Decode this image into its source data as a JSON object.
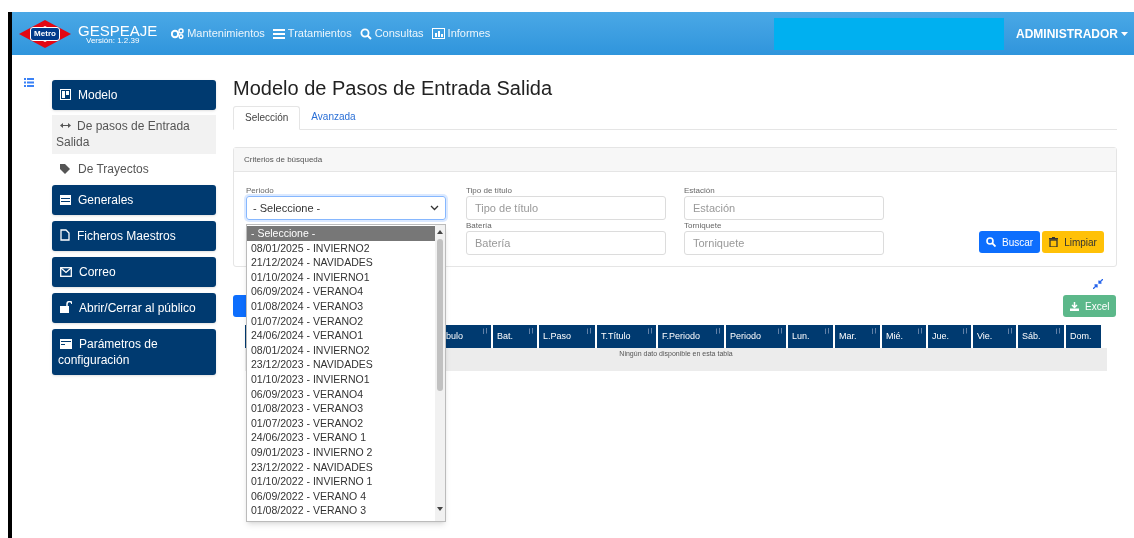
{
  "navbar": {
    "logo_text": "Metro",
    "app_name": "GESPEAJE",
    "version": "Versión: 1.2.39",
    "menu": [
      {
        "label": "Mantenimientos"
      },
      {
        "label": "Tratamientos"
      },
      {
        "label": "Consultas"
      },
      {
        "label": "Informes"
      }
    ],
    "user": "ADMINISTRADOR"
  },
  "sidebar": {
    "items": [
      {
        "kind": "section",
        "label": "Modelo",
        "children": [
          {
            "label": "De pasos de Entrada Salida",
            "selected": true
          },
          {
            "label": "De Trayectos",
            "selected": false
          }
        ]
      },
      {
        "kind": "section",
        "label": "Generales"
      },
      {
        "kind": "section",
        "label": "Ficheros Maestros"
      },
      {
        "kind": "section",
        "label": "Correo"
      },
      {
        "kind": "section",
        "label": "Abrir/Cerrar al público"
      },
      {
        "kind": "section",
        "label": "Parámetros de configuración"
      }
    ]
  },
  "page_title": "Modelo de Pasos de Entrada Salida",
  "tabs": [
    {
      "label": "Selección",
      "selected": true
    },
    {
      "label": "Avanzada",
      "selected": false
    }
  ],
  "search_card": {
    "header": "Criterios de búsqueda",
    "periodo": {
      "label": "Periodo",
      "value": "- Seleccione -"
    },
    "fields": [
      {
        "label": "Tipo de título",
        "placeholder": "Tipo de título"
      },
      {
        "label": "Estación",
        "placeholder": "Estación"
      },
      {
        "label": "Batería",
        "placeholder": "Batería"
      },
      {
        "label": "Torniquete",
        "placeholder": "Torniquete"
      }
    ],
    "buttons": [
      {
        "kind": "primary",
        "label": "Buscar"
      },
      {
        "kind": "warning",
        "label": "Limpiar"
      }
    ]
  },
  "excel_button": "Excel",
  "table": {
    "columns": [
      "bulo",
      "Bat.",
      "L.Paso",
      "T.Título",
      "F.Periodo",
      "Periodo",
      "Lun.",
      "Mar.",
      "Mié.",
      "Jue.",
      "Vie.",
      "Sáb.",
      "Dom."
    ],
    "empty_message": "Ningún dato disponible en esta tabla"
  },
  "dropdown_options": [
    {
      "label": "- Seleccione -",
      "selected": true
    },
    {
      "label": "08/01/2025 - INVIERNO2",
      "selected": false
    },
    {
      "label": "21/12/2024 - NAVIDADES",
      "selected": false
    },
    {
      "label": "01/10/2024 - INVIERNO1",
      "selected": false
    },
    {
      "label": "06/09/2024 - VERANO4",
      "selected": false
    },
    {
      "label": "01/08/2024 - VERANO3",
      "selected": false
    },
    {
      "label": "01/07/2024 - VERANO2",
      "selected": false
    },
    {
      "label": "24/06/2024 - VERANO1",
      "selected": false
    },
    {
      "label": "08/01/2024 - INVIERNO2",
      "selected": false
    },
    {
      "label": "23/12/2023 - NAVIDADES",
      "selected": false
    },
    {
      "label": "01/10/2023 - INVIERNO1",
      "selected": false
    },
    {
      "label": "06/09/2023 - VERANO4",
      "selected": false
    },
    {
      "label": "01/08/2023 - VERANO3",
      "selected": false
    },
    {
      "label": "01/07/2023 - VERANO2",
      "selected": false
    },
    {
      "label": "24/06/2023 - VERANO 1",
      "selected": false
    },
    {
      "label": "09/01/2023 - INVIERNO 2",
      "selected": false
    },
    {
      "label": "23/12/2022 - NAVIDADES",
      "selected": false
    },
    {
      "label": "01/10/2022 - INVIERNO 1",
      "selected": false
    },
    {
      "label": "06/09/2022 - VERANO 4",
      "selected": false
    },
    {
      "label": "01/08/2022 - VERANO 3",
      "selected": false
    }
  ]
}
